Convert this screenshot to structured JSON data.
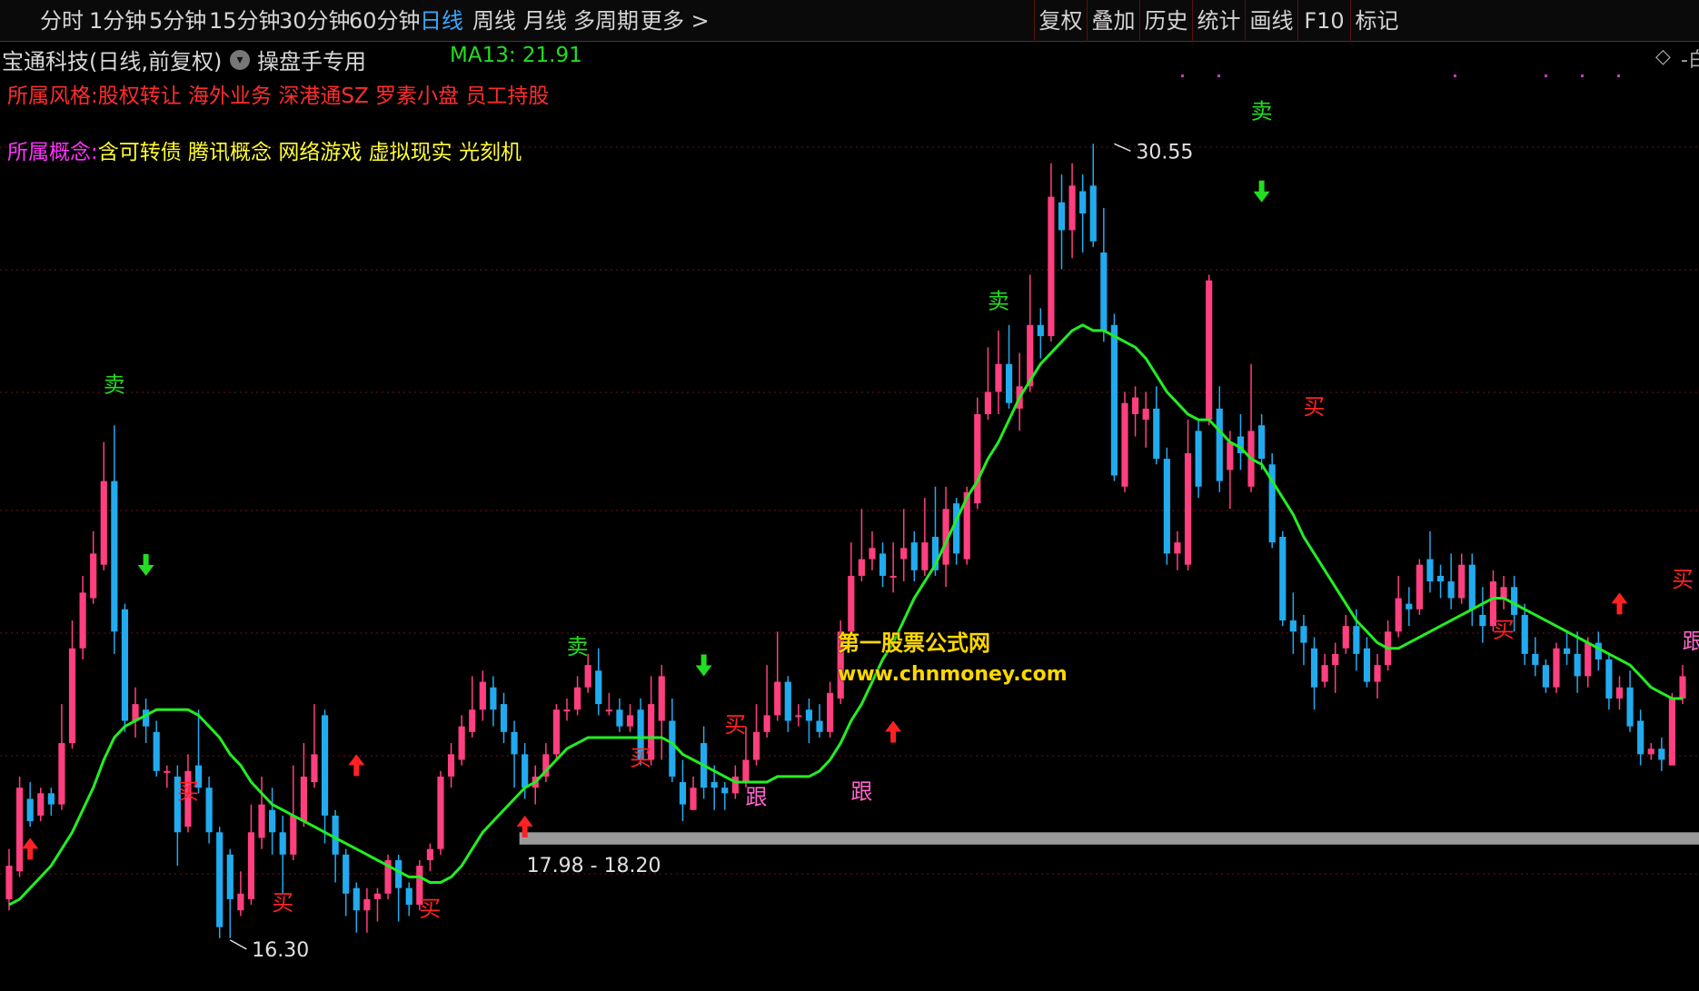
{
  "toolbar": {
    "periods": [
      "分时",
      "1分钟",
      "5分钟",
      "15分钟",
      "30分钟",
      "60分钟",
      "日线",
      "周线",
      "月线",
      "多周期",
      "更多 >"
    ],
    "active_period": "日线",
    "tools": [
      "复权",
      "叠加",
      "历史",
      "统计",
      "画线",
      "F10",
      "标记"
    ]
  },
  "info": {
    "stock_title": "宝通科技(日线,前复权)",
    "dropdown_icon": "chevron-down-icon",
    "formula_name": "操盘手专用",
    "ma_label": "MA13: 21.91",
    "diamond_icon": "diamond-icon",
    "edge_text": "-白"
  },
  "tags": {
    "style_key": "所属风格:",
    "style_value": "股权转让 海外业务 深港通SZ 罗素小盘 员工持股",
    "concept_key": "所属概念:",
    "concept_value": "含可转债 腾讯概念 网络游戏 虚拟现实 光刻机"
  },
  "colors": {
    "up": "#ff3f7f",
    "down": "#22aaee",
    "ma": "#22ee22",
    "grid": "#7a1010",
    "buy_signal": "#ff2222",
    "sell_signal": "#22dd22",
    "follow_signal": "#ff66cc",
    "band": "#9a9a9a"
  },
  "chart_data": {
    "type": "candlestick",
    "y_range": [
      15.5,
      31.5
    ],
    "high_label": "30.55",
    "low_label": "16.30",
    "band_label": "17.98 - 18.20",
    "ma_name": "MA13",
    "candles": [
      [
        17.0,
        17.6,
        17.9,
        16.8
      ],
      [
        17.5,
        19.0,
        19.2,
        17.4
      ],
      [
        18.8,
        18.4,
        19.1,
        18.3
      ],
      [
        18.5,
        18.9,
        19.0,
        18.4
      ],
      [
        18.9,
        18.7,
        19.0,
        18.5
      ],
      [
        18.7,
        19.8,
        20.5,
        18.6
      ],
      [
        19.8,
        21.5,
        22.0,
        19.7
      ],
      [
        21.5,
        22.5,
        22.8,
        21.3
      ],
      [
        22.4,
        23.2,
        23.6,
        22.3
      ],
      [
        23.0,
        24.5,
        25.2,
        22.9
      ],
      [
        24.5,
        21.8,
        25.5,
        21.4
      ],
      [
        22.2,
        20.2,
        22.3,
        20.0
      ],
      [
        20.2,
        20.5,
        20.8,
        19.9
      ],
      [
        20.4,
        20.1,
        20.6,
        19.8
      ],
      [
        20.0,
        19.3,
        20.2,
        19.2
      ],
      [
        19.3,
        19.3,
        19.4,
        19.0
      ],
      [
        19.2,
        18.2,
        19.4,
        17.6
      ],
      [
        18.3,
        19.3,
        19.6,
        18.2
      ],
      [
        19.4,
        19.0,
        20.4,
        18.9
      ],
      [
        19.0,
        18.2,
        19.2,
        18.0
      ],
      [
        18.2,
        16.5,
        18.3,
        16.3
      ],
      [
        17.8,
        17.0,
        17.9,
        16.3
      ],
      [
        16.8,
        17.1,
        17.5,
        16.7
      ],
      [
        17.0,
        18.2,
        18.7,
        16.9
      ],
      [
        18.1,
        18.7,
        19.2,
        17.9
      ],
      [
        18.6,
        18.2,
        19.0,
        17.8
      ],
      [
        18.2,
        17.8,
        18.5,
        17.1
      ],
      [
        17.8,
        18.5,
        19.4,
        17.7
      ],
      [
        18.4,
        19.2,
        19.8,
        18.3
      ],
      [
        19.1,
        19.6,
        20.5,
        19.0
      ],
      [
        20.3,
        18.5,
        20.4,
        18.0
      ],
      [
        18.5,
        17.8,
        18.6,
        17.3
      ],
      [
        17.8,
        17.1,
        17.9,
        16.7
      ],
      [
        17.2,
        16.8,
        17.3,
        16.4
      ],
      [
        16.8,
        17.0,
        17.2,
        16.4
      ],
      [
        17.0,
        17.1,
        17.2,
        16.6
      ],
      [
        17.1,
        17.7,
        17.8,
        17.0
      ],
      [
        17.7,
        17.2,
        17.8,
        16.6
      ],
      [
        17.2,
        16.9,
        17.3,
        16.7
      ],
      [
        16.9,
        17.6,
        17.7,
        16.8
      ],
      [
        17.7,
        17.9,
        18.0,
        17.5
      ],
      [
        17.9,
        19.2,
        19.3,
        17.8
      ],
      [
        19.2,
        19.6,
        19.8,
        19.0
      ],
      [
        19.5,
        20.1,
        20.3,
        19.4
      ],
      [
        20.0,
        20.4,
        21.0,
        19.9
      ],
      [
        20.4,
        20.9,
        21.1,
        20.2
      ],
      [
        20.8,
        20.4,
        21.0,
        20.1
      ],
      [
        20.5,
        20.0,
        20.7,
        19.8
      ],
      [
        20.0,
        19.6,
        20.2,
        19.0
      ],
      [
        19.6,
        19.0,
        19.8,
        18.8
      ],
      [
        19.0,
        19.2,
        19.4,
        18.7
      ],
      [
        19.2,
        19.6,
        19.8,
        19.1
      ],
      [
        19.6,
        20.4,
        20.5,
        19.5
      ],
      [
        20.4,
        20.4,
        20.6,
        20.2
      ],
      [
        20.4,
        20.8,
        21.0,
        20.3
      ],
      [
        20.8,
        21.2,
        21.4,
        20.7
      ],
      [
        21.1,
        20.5,
        21.5,
        20.3
      ],
      [
        20.4,
        20.4,
        20.7,
        20.3
      ],
      [
        20.4,
        20.1,
        20.6,
        20.0
      ],
      [
        20.1,
        20.3,
        20.5,
        20.0
      ],
      [
        20.4,
        19.5,
        20.6,
        19.4
      ],
      [
        19.5,
        20.5,
        21.0,
        19.4
      ],
      [
        20.2,
        21.0,
        21.2,
        19.5
      ],
      [
        20.2,
        19.2,
        20.6,
        19.1
      ],
      [
        19.1,
        18.7,
        19.5,
        18.4
      ],
      [
        18.6,
        19.0,
        19.2,
        18.6
      ],
      [
        19.8,
        19.0,
        20.1,
        18.8
      ],
      [
        19.1,
        19.0,
        19.4,
        18.6
      ],
      [
        19.0,
        18.9,
        19.1,
        18.6
      ],
      [
        18.9,
        19.2,
        19.4,
        18.8
      ],
      [
        19.1,
        19.5,
        20.1,
        19.0
      ],
      [
        19.5,
        20.0,
        20.5,
        19.4
      ],
      [
        20.0,
        20.3,
        21.2,
        19.9
      ],
      [
        20.3,
        20.9,
        21.8,
        20.2
      ],
      [
        20.9,
        20.2,
        21.0,
        20.0
      ],
      [
        20.3,
        20.3,
        20.5,
        20.1
      ],
      [
        20.4,
        20.2,
        20.6,
        19.8
      ],
      [
        20.2,
        20.0,
        20.5,
        19.9
      ],
      [
        20.0,
        20.7,
        20.9,
        19.9
      ],
      [
        20.6,
        21.8,
        22.0,
        20.5
      ],
      [
        21.8,
        22.8,
        23.4,
        21.7
      ],
      [
        22.8,
        23.1,
        24.0,
        22.7
      ],
      [
        23.1,
        23.3,
        23.6,
        22.9
      ],
      [
        23.2,
        22.8,
        23.4,
        22.6
      ],
      [
        22.8,
        22.8,
        23.4,
        22.5
      ],
      [
        23.1,
        23.3,
        24.0,
        22.7
      ],
      [
        23.4,
        22.9,
        23.6,
        22.7
      ],
      [
        22.9,
        23.4,
        24.2,
        22.8
      ],
      [
        23.5,
        22.9,
        24.4,
        22.8
      ],
      [
        23.0,
        24.0,
        24.4,
        22.6
      ],
      [
        24.1,
        23.2,
        24.2,
        23.0
      ],
      [
        23.1,
        24.3,
        24.4,
        23.0
      ],
      [
        24.1,
        25.7,
        26.0,
        24.0
      ],
      [
        25.7,
        26.1,
        26.9,
        25.6
      ],
      [
        26.1,
        26.6,
        27.2,
        25.7
      ],
      [
        26.6,
        25.9,
        27.3,
        25.8
      ],
      [
        25.8,
        26.2,
        26.8,
        25.4
      ],
      [
        26.2,
        27.3,
        28.2,
        26.1
      ],
      [
        27.3,
        27.1,
        27.6,
        26.7
      ],
      [
        27.1,
        29.6,
        30.2,
        27.0
      ],
      [
        29.5,
        29.0,
        30.0,
        28.3
      ],
      [
        29.0,
        29.8,
        30.2,
        28.5
      ],
      [
        29.7,
        29.3,
        30.0,
        28.6
      ],
      [
        29.8,
        28.8,
        30.55,
        28.7
      ],
      [
        28.6,
        27.2,
        29.4,
        27.0
      ],
      [
        27.3,
        24.6,
        27.5,
        24.5
      ],
      [
        24.4,
        25.9,
        26.1,
        24.3
      ],
      [
        25.7,
        26.0,
        26.2,
        25.3
      ],
      [
        25.6,
        25.8,
        26.1,
        25.1
      ],
      [
        25.8,
        24.9,
        26.2,
        24.8
      ],
      [
        24.9,
        23.2,
        25.1,
        23.0
      ],
      [
        23.2,
        23.4,
        23.6,
        22.9
      ],
      [
        23.0,
        25.0,
        25.6,
        22.9
      ],
      [
        25.4,
        24.4,
        25.6,
        24.2
      ],
      [
        25.6,
        28.1,
        28.2,
        25.5
      ],
      [
        25.8,
        24.5,
        26.2,
        24.3
      ],
      [
        24.7,
        25.2,
        25.4,
        24.0
      ],
      [
        25.3,
        25.0,
        25.7,
        24.7
      ],
      [
        24.4,
        25.4,
        26.6,
        24.3
      ],
      [
        25.5,
        24.9,
        25.7,
        24.7
      ],
      [
        24.8,
        23.4,
        25.0,
        23.3
      ],
      [
        23.5,
        22.0,
        23.6,
        21.9
      ],
      [
        22.0,
        21.8,
        22.5,
        21.4
      ],
      [
        21.9,
        21.6,
        22.1,
        21.2
      ],
      [
        21.5,
        20.8,
        21.7,
        20.4
      ],
      [
        20.9,
        21.2,
        21.4,
        20.8
      ],
      [
        21.2,
        21.4,
        21.6,
        20.7
      ],
      [
        21.5,
        21.9,
        22.1,
        21.4
      ],
      [
        21.9,
        21.4,
        22.2,
        21.1
      ],
      [
        21.5,
        20.9,
        21.7,
        20.8
      ],
      [
        20.9,
        21.2,
        21.4,
        20.6
      ],
      [
        21.2,
        21.8,
        22.0,
        21.1
      ],
      [
        21.8,
        22.4,
        22.8,
        21.7
      ],
      [
        22.3,
        22.2,
        22.6,
        21.9
      ],
      [
        22.2,
        23.0,
        23.1,
        22.1
      ],
      [
        23.1,
        22.7,
        23.6,
        22.5
      ],
      [
        22.8,
        22.7,
        23.0,
        22.4
      ],
      [
        22.7,
        22.4,
        23.2,
        22.2
      ],
      [
        22.4,
        23.0,
        23.2,
        22.3
      ],
      [
        23.0,
        22.2,
        23.2,
        21.9
      ],
      [
        22.1,
        21.9,
        22.6,
        21.6
      ],
      [
        21.9,
        22.7,
        22.9,
        21.8
      ],
      [
        22.4,
        22.6,
        22.8,
        22.2
      ],
      [
        22.6,
        22.1,
        22.8,
        21.8
      ],
      [
        22.1,
        21.4,
        22.3,
        21.2
      ],
      [
        21.4,
        21.2,
        21.7,
        21.0
      ],
      [
        21.2,
        20.8,
        21.3,
        20.7
      ],
      [
        20.8,
        21.5,
        21.6,
        20.7
      ],
      [
        21.5,
        21.4,
        21.8,
        21.2
      ],
      [
        21.4,
        21.0,
        21.8,
        20.7
      ],
      [
        21.0,
        21.6,
        21.7,
        20.8
      ],
      [
        21.6,
        21.3,
        21.8,
        21.1
      ],
      [
        21.3,
        20.6,
        21.4,
        20.4
      ],
      [
        20.6,
        20.8,
        21.0,
        20.4
      ],
      [
        20.8,
        20.1,
        21.1,
        20.0
      ],
      [
        20.2,
        19.6,
        20.4,
        19.4
      ],
      [
        19.6,
        19.7,
        19.8,
        19.5
      ],
      [
        19.7,
        19.5,
        19.9,
        19.3
      ],
      [
        19.4,
        20.6,
        20.7,
        19.4
      ],
      [
        20.6,
        21.0,
        21.2,
        20.5
      ]
    ],
    "ma13": [
      16.9,
      17.0,
      17.2,
      17.4,
      17.6,
      17.9,
      18.2,
      18.6,
      19.0,
      19.5,
      19.9,
      20.1,
      20.2,
      20.3,
      20.4,
      20.4,
      20.4,
      20.4,
      20.3,
      20.1,
      19.9,
      19.6,
      19.4,
      19.1,
      18.9,
      18.7,
      18.6,
      18.5,
      18.4,
      18.3,
      18.2,
      18.1,
      18.0,
      17.9,
      17.8,
      17.7,
      17.6,
      17.5,
      17.4,
      17.4,
      17.3,
      17.3,
      17.4,
      17.6,
      17.9,
      18.2,
      18.4,
      18.6,
      18.8,
      19.0,
      19.1,
      19.3,
      19.5,
      19.7,
      19.8,
      19.9,
      19.9,
      19.9,
      19.9,
      19.9,
      19.9,
      19.9,
      19.9,
      19.8,
      19.6,
      19.5,
      19.4,
      19.3,
      19.2,
      19.1,
      19.1,
      19.1,
      19.1,
      19.2,
      19.2,
      19.2,
      19.2,
      19.3,
      19.5,
      19.8,
      20.2,
      20.5,
      20.9,
      21.3,
      21.6,
      22.0,
      22.4,
      22.7,
      23.0,
      23.4,
      23.8,
      24.2,
      24.5,
      24.9,
      25.2,
      25.6,
      26.0,
      26.3,
      26.6,
      26.8,
      27.0,
      27.2,
      27.3,
      27.2,
      27.2,
      27.1,
      27.0,
      26.9,
      26.7,
      26.4,
      26.1,
      25.9,
      25.7,
      25.6,
      25.6,
      25.4,
      25.2,
      25.1,
      24.9,
      24.8,
      24.5,
      24.2,
      23.9,
      23.5,
      23.2,
      22.9,
      22.6,
      22.3,
      22.0,
      21.8,
      21.6,
      21.5,
      21.5,
      21.6,
      21.7,
      21.8,
      21.9,
      22.0,
      22.1,
      22.2,
      22.3,
      22.4,
      22.4,
      22.3,
      22.2,
      22.1,
      22.0,
      21.9,
      21.8,
      21.7,
      21.6,
      21.5,
      21.4,
      21.3,
      21.2,
      21.0,
      20.8,
      20.7,
      20.6,
      20.6
    ]
  },
  "signals": [
    {
      "text": "卖",
      "type": "sell",
      "i": 10,
      "pos": 26.1
    },
    {
      "text": "卖",
      "type": "sell",
      "i": 54,
      "pos": 21.4
    },
    {
      "text": "卖",
      "type": "sell",
      "i": 94,
      "pos": 27.6
    },
    {
      "text": "卖",
      "type": "sell",
      "i": 119,
      "pos": 31.0
    },
    {
      "text": "买",
      "type": "buy",
      "i": 17,
      "pos": 18.8
    },
    {
      "text": "买",
      "type": "buy",
      "i": 26,
      "pos": 16.8
    },
    {
      "text": "买",
      "type": "buy",
      "i": 40,
      "pos": 16.7
    },
    {
      "text": "买",
      "type": "buy",
      "i": 60,
      "pos": 19.4
    },
    {
      "text": "买",
      "type": "buy",
      "i": 69,
      "pos": 20.0
    },
    {
      "text": "买",
      "type": "buy",
      "i": 124,
      "pos": 25.7
    },
    {
      "text": "买",
      "type": "buy",
      "i": 142,
      "pos": 21.7
    },
    {
      "text": "买",
      "type": "buy",
      "i": 159,
      "pos": 22.6
    },
    {
      "text": "买",
      "type": "buy",
      "i": 177,
      "pos": 21.1
    },
    {
      "text": "跟",
      "type": "follow",
      "i": 71,
      "pos": 18.7
    },
    {
      "text": "跟",
      "type": "follow",
      "i": 81,
      "pos": 18.8
    },
    {
      "text": "跟",
      "type": "follow",
      "i": 160,
      "pos": 21.5
    }
  ],
  "arrows": [
    {
      "dir": "down",
      "i": 13,
      "pos": 22.8
    },
    {
      "dir": "down",
      "i": 119,
      "pos": 29.5
    },
    {
      "dir": "down",
      "i": 66,
      "pos": 21.0
    },
    {
      "dir": "up",
      "i": 2,
      "pos": 18.1
    },
    {
      "dir": "up",
      "i": 33,
      "pos": 19.6
    },
    {
      "dir": "up",
      "i": 49,
      "pos": 18.5
    },
    {
      "dir": "up",
      "i": 84,
      "pos": 20.2
    },
    {
      "dir": "up",
      "i": 153,
      "pos": 22.5
    },
    {
      "dir": "up",
      "i": 181,
      "pos": 20.3
    }
  ],
  "watermark": {
    "line1": "第一股票公式网",
    "line2": "www.chnmoney.com"
  }
}
